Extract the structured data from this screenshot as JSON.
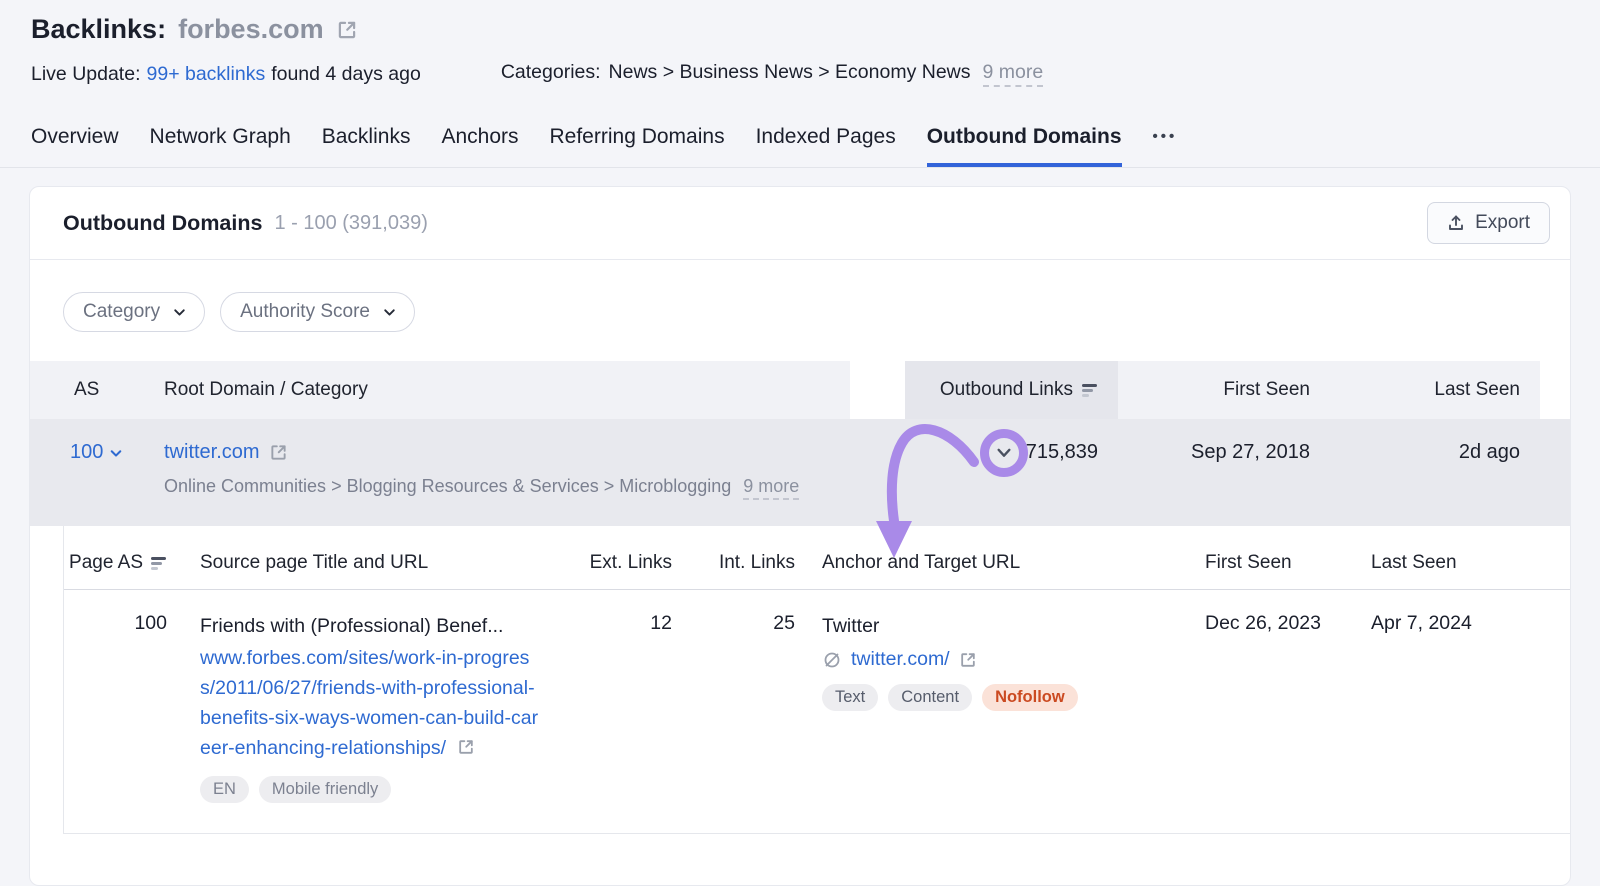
{
  "page": {
    "title_prefix": "Backlinks:",
    "title_domain": "forbes.com",
    "live_update": {
      "label": "Live Update:",
      "link": "99+ backlinks",
      "suffix": "found 4 days ago"
    },
    "categories": {
      "label": "Categories:",
      "path": "News > Business News > Economy News",
      "more": "9 more"
    }
  },
  "tabs": {
    "items": [
      "Overview",
      "Network Graph",
      "Backlinks",
      "Anchors",
      "Referring Domains",
      "Indexed Pages",
      "Outbound Domains"
    ],
    "active": "Outbound Domains",
    "more": "•••"
  },
  "card": {
    "title": "Outbound Domains",
    "range": "1 - 100 (391,039)",
    "export_label": "Export",
    "filters": [
      {
        "label": "Category"
      },
      {
        "label": "Authority Score"
      }
    ]
  },
  "main_table": {
    "columns": [
      "AS",
      "Root Domain / Category",
      "Outbound Links",
      "First Seen",
      "Last Seen"
    ],
    "row": {
      "as": "100",
      "domain": "twitter.com",
      "category_path": "Online Communities > Blogging Resources & Services > Microblogging",
      "category_more": "9 more",
      "outbound_links": "715,839",
      "first_seen": "Sep 27, 2018",
      "last_seen": "2d ago"
    }
  },
  "sub_table": {
    "columns": [
      "Page AS",
      "Source page Title and URL",
      "Ext. Links",
      "Int. Links",
      "Anchor and Target URL",
      "First Seen",
      "Last Seen"
    ],
    "row": {
      "page_as": "100",
      "title": "Friends with (Professional) Benef...",
      "url": "www.forbes.com/sites/work-in-progress/2011/06/27/friends-with-professional-benefits-six-ways-women-can-build-career-enhancing-relationships/",
      "tags": [
        "EN",
        "Mobile friendly"
      ],
      "ext_links": "12",
      "int_links": "25",
      "anchor": "Twitter",
      "target_url": "twitter.com/",
      "link_tags": [
        "Text",
        "Content"
      ],
      "nofollow_tag": "Nofollow",
      "first_seen": "Dec 26, 2023",
      "last_seen": "Apr 7, 2024"
    }
  },
  "icons": {
    "external-link-icon": "box-with-arrow-up-right",
    "info-icon": "serif-italic-i",
    "chevron-down-icon": "v-chevron",
    "sort-desc-icon": "three-decreasing-bars",
    "export-icon": "upload-tray-arrow",
    "noindex-icon": "slashed-circle",
    "more-tabs-icon": "three-dots"
  },
  "colors": {
    "link_blue": "#2e6ad1",
    "active_tab_blue": "#3263d9",
    "annotation_purple": "#a98ae8",
    "nofollow_text": "#cb4a21",
    "nofollow_bg": "#fbe2d8",
    "row_highlight": "#e8e9ee",
    "sorted_column_bg": "#e5e6ec",
    "header_bg": "#f1f2f6"
  }
}
